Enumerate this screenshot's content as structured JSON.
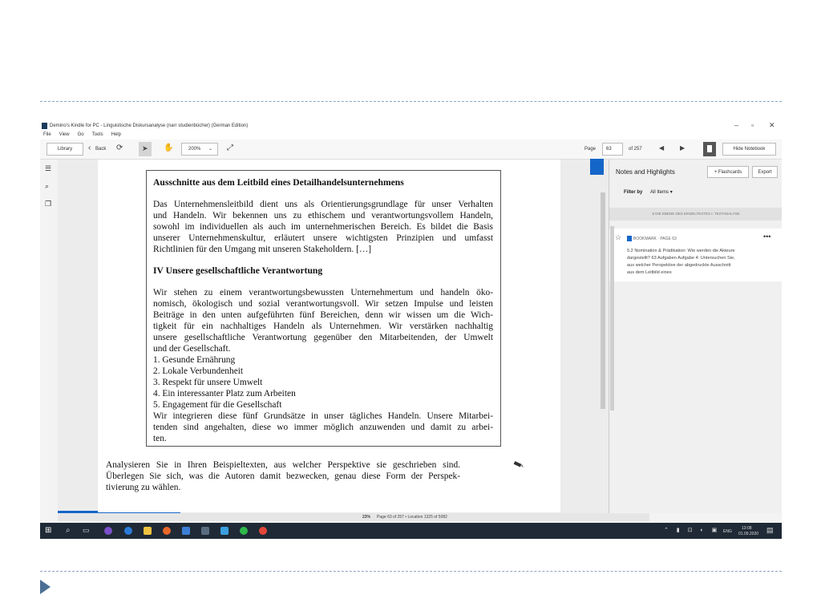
{
  "window": {
    "title": "Demino's Kindle for PC - Linguistische Diskursanalyse (narr studienbücher) (German Edition)",
    "controls": [
      "–",
      "▫",
      "✕"
    ]
  },
  "menu": [
    "File",
    "View",
    "Go",
    "Tools",
    "Help"
  ],
  "toolbar": {
    "library": "Library",
    "back": "Back",
    "zoom": "200%",
    "page_label": "Page",
    "page_value": "63",
    "of_pages": "of 257",
    "hide_notebook": "Hide Notebook"
  },
  "book": {
    "box_heading": "Ausschnitte aus dem Leitbild eines Detailhandelsunternehmens",
    "para1": [
      "Das Unternehmensleitbild dient uns als Orientierungsgrundlage für unser Verhalten",
      "und Handeln. Wir bekennen uns zu ethischem und verantwortungsvollem Handeln,",
      "sowohl im individuellen als auch im unternehmerischen Bereich. Es bildet die Basis",
      "unserer Unternehmenskultur, erläutert unsere wichtigsten Prinzipien und umfasst",
      "Richtlinien für den Umgang mit unseren Stakeholdern. […]"
    ],
    "section_heading": "IV Unsere gesellschaftliche Verantwortung",
    "para2": [
      "Wir stehen zu einem verantwortungsbewussten Unternehmertum und handeln öko-",
      "nomisch, ökologisch und sozial verantwortungsvoll. Wir setzen Impulse und leisten",
      "Beiträge in den unten aufgeführten fünf Bereichen, denn wir wissen um die Wich-",
      "tigkeit für ein nachhaltiges Handeln als Unternehmen. Wir verstärken nachhaltig",
      "unsere gesellschaftliche Verantwortung gegenüber den Mitarbeitenden, der Umwelt",
      "und der Gesellschaft."
    ],
    "list": [
      "1. Gesunde Ernährung",
      "2. Lokale Verbundenheit",
      "3. Respekt für unsere Umwelt",
      "4. Ein interessanter Platz zum Arbeiten",
      "5. Engagement für die Gesellschaft"
    ],
    "para3": [
      "Wir integrieren diese fünf Grundsätze in unser tägliches Handeln. Unsere Mitarbei-",
      "tenden sind angehalten, diese wo immer möglich anzuwenden und damit zu arbei-",
      "ten."
    ],
    "after_box": [
      "Analysieren Sie in Ihren Beispieltexten, aus welcher Perspektive sie geschrieben sind.",
      "Überlegen Sie sich, was die Autoren damit bezwecken, genau diese Form der Perspek-",
      "tivierung zu wählen."
    ]
  },
  "status": {
    "percent": "23%",
    "text": "Page 63 of 257  •  Location 1325 of 5082",
    "progress_fraction": 0.23
  },
  "notes": {
    "title": "Notes and Highlights",
    "flashcards": "+ Flashcards",
    "export": "Export",
    "filter_label": "Filter by",
    "filter_value": "All Items",
    "section": "5 DIE EBENE DES EINZELTEXTES I: TEXTANALYSE",
    "card": {
      "label": "BOOKMARK · PAGE 63",
      "lines": [
        "5.2 Nomination & Prädikation: Wie werden die Akteure",
        "dargestellt? 63 Aufgaben Aufgabe 4: Untersuchen Sie,",
        "aus welcher Perspektive der abgedruckte Ausschnitt",
        "aus dem Leitbild eines"
      ]
    }
  },
  "taskbar": {
    "lang": "ENG",
    "time": "13:08",
    "date": "01.09.2020"
  }
}
